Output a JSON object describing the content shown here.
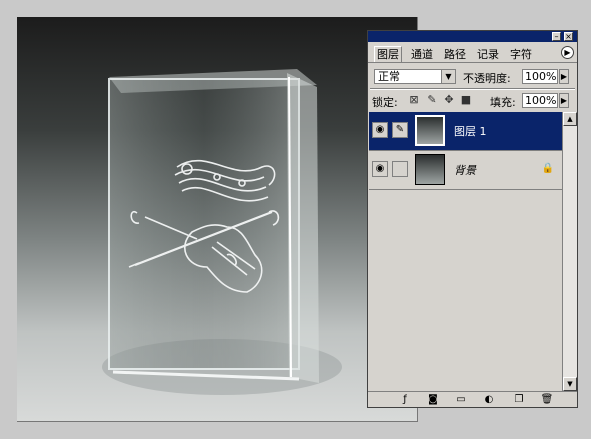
{
  "panel": {
    "tabs": [
      "图层",
      "通道",
      "路径",
      "记录",
      "字符"
    ],
    "blend_mode": "正常",
    "opacity_label": "不透明度:",
    "opacity_value": "100%",
    "lock_label": "锁定:",
    "fill_label": "填充:",
    "fill_value": "100%",
    "layers": [
      {
        "name": "图层 1",
        "selected": true
      },
      {
        "name": "背景",
        "selected": false,
        "locked": true
      }
    ]
  },
  "icons": {
    "eye": "eye-icon",
    "brush": "brush-icon",
    "lock": "lock-icon",
    "menu": "panel-menu-arrow-icon",
    "bottom": [
      "layer-style-icon",
      "mask-icon",
      "new-group-icon",
      "adjustment-layer-icon",
      "new-layer-icon",
      "trash-icon"
    ]
  },
  "colors": {
    "selection": "#0a246a",
    "panel_bg": "#d6d3ce"
  }
}
